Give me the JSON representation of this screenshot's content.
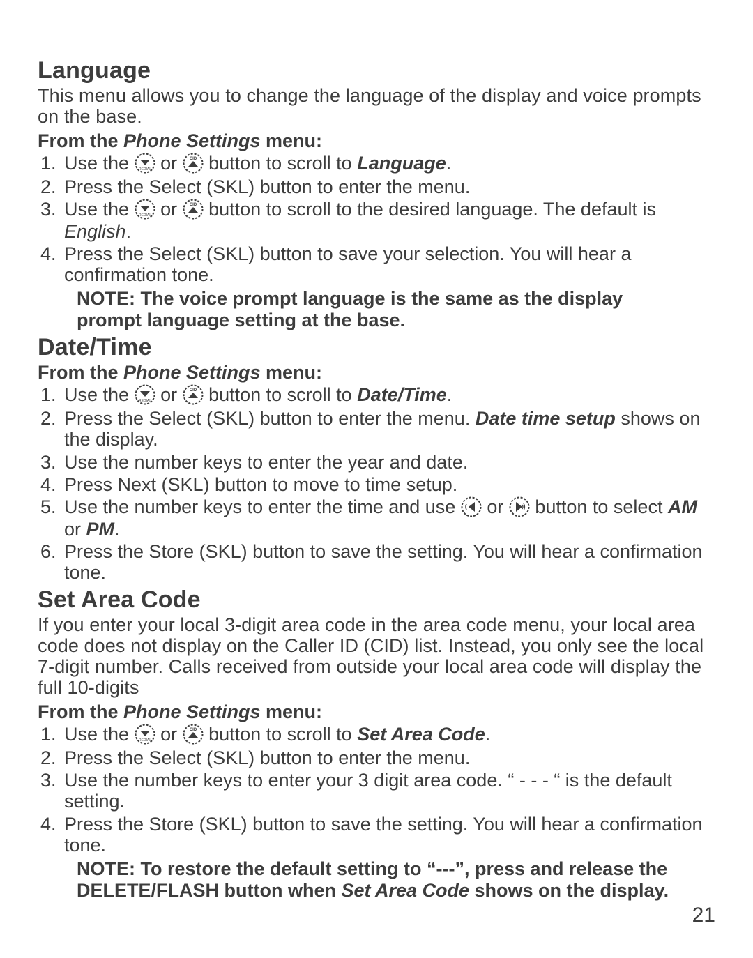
{
  "page_number": "21",
  "icons": {
    "down_label": "REDIAL down",
    "up_label": "CID up",
    "left_label": "volume left",
    "right_label": "speaker right"
  },
  "language": {
    "heading": "Language",
    "intro": "This menu allows you to change the language of the display and voice prompts on the base.",
    "from_prefix": "From the ",
    "from_menu": "Phone Settings",
    "from_suffix": " menu:",
    "step1_a": "Use the ",
    "step1_b": " or ",
    "step1_c": " button to scroll to ",
    "step1_target": "Language",
    "step1_end": ".",
    "step2": "Press the Select (SKL) button to enter the menu.",
    "step3_a": "Use the ",
    "step3_b": " or ",
    "step3_c": " button to scroll to the desired language. The default is ",
    "step3_default": "English",
    "step3_end": ".",
    "step4": "Press the Select (SKL) button to save your selection. You will hear a confirmation tone.",
    "note": "NOTE: The voice prompt language is the same as the display prompt language setting at the base."
  },
  "datetime": {
    "heading": "Date/Time",
    "from_prefix": "From the ",
    "from_menu": "Phone Settings",
    "from_suffix": " menu:",
    "step1_a": "Use the ",
    "step1_b": " or ",
    "step1_c": " button to scroll to ",
    "step1_target": "Date/Time",
    "step1_end": ".",
    "step2_a": "Press the Select (SKL) button to enter the menu. ",
    "step2_target": "Date time setup",
    "step2_b": " shows on the display.",
    "step3": "Use the number keys to enter the year and date.",
    "step4": "Press Next (SKL) button to move to time setup.",
    "step5_a": "Use the number keys to enter the time and use ",
    "step5_b": " or ",
    "step5_c": " button to select ",
    "step5_am": "AM",
    "step5_or": " or ",
    "step5_pm": "PM",
    "step5_end": ".",
    "step6": "Press the Store (SKL) button to save the setting. You will hear a confirmation tone."
  },
  "areacode": {
    "heading": "Set Area Code",
    "intro": "If you enter your local 3-digit area code in the area code menu, your local area code does not display on the Caller ID (CID) list. Instead, you only see the local 7-digit number. Calls received from outside your local area code will display the full 10-digits",
    "from_prefix": "From the ",
    "from_menu": "Phone Settings",
    "from_suffix": " menu:",
    "step1_a": "Use the ",
    "step1_b": " or ",
    "step1_c": " button to scroll to ",
    "step1_target": "Set Area Code",
    "step1_end": ".",
    "step2": "Press the Select (SKL) button to enter the menu.",
    "step3": "Use the number keys to enter your 3 digit area code. “ - - - “ is the default setting.",
    "step4": "Press the Store (SKL) button to save the setting. You will hear a confirmation tone.",
    "note_a": "NOTE: To restore the default setting to “---”, press and release the DELETE/FLASH button when ",
    "note_target": "Set Area Code",
    "note_b": " shows on the display."
  }
}
